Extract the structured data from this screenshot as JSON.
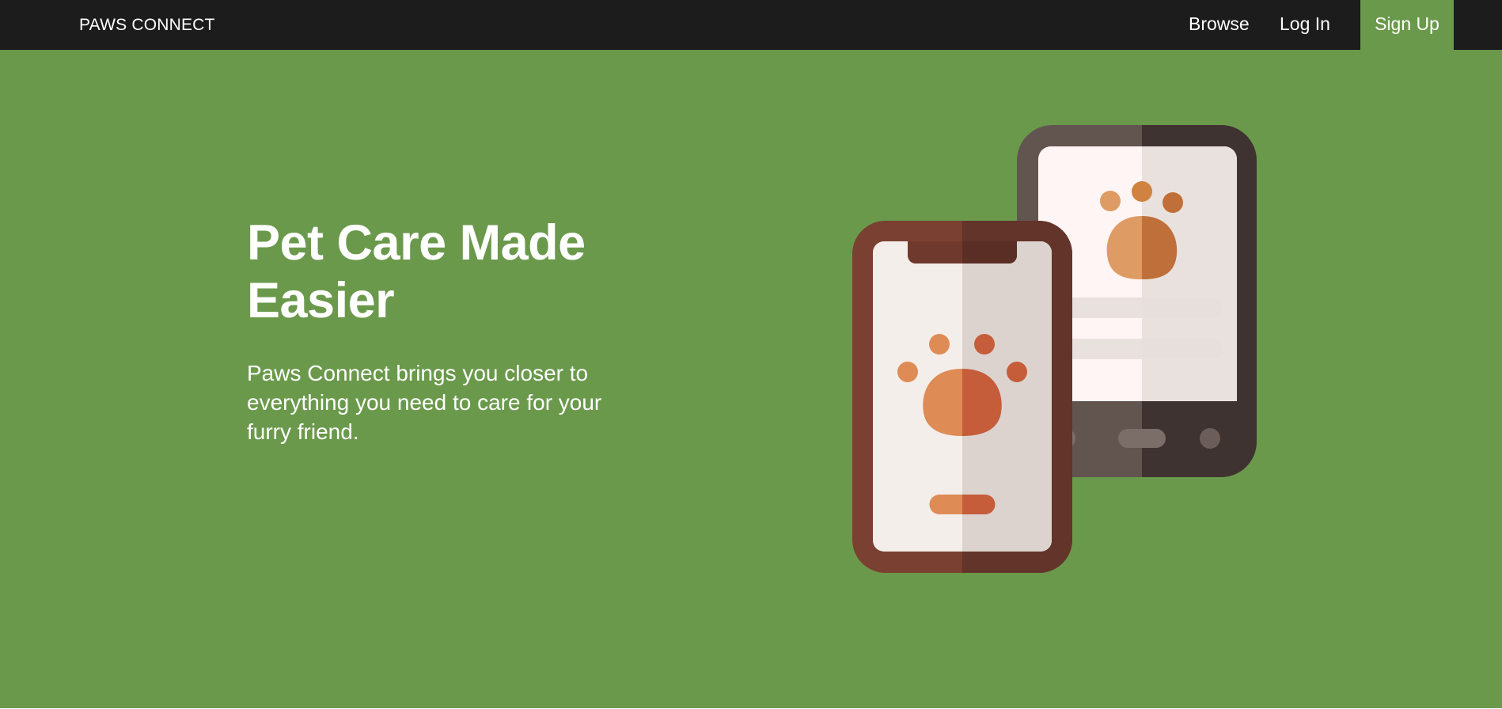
{
  "nav": {
    "brand": "PAWS CONNECT",
    "links": {
      "browse": "Browse",
      "login": "Log In",
      "signup": "Sign Up"
    }
  },
  "hero": {
    "title": "Pet Care Made Easier",
    "subtitle": "Paws Connect brings you closer to everything you need to care for your furry friend.",
    "illustration_icon": "two-phones-paw-icon"
  },
  "colors": {
    "navbar": "#1c1c1c",
    "accent_green": "#6a994b",
    "text": "#ffffff",
    "phone_front_frame": "#7a4031",
    "phone_back_frame": "#625550",
    "paw_orange": "#dd8b55"
  }
}
